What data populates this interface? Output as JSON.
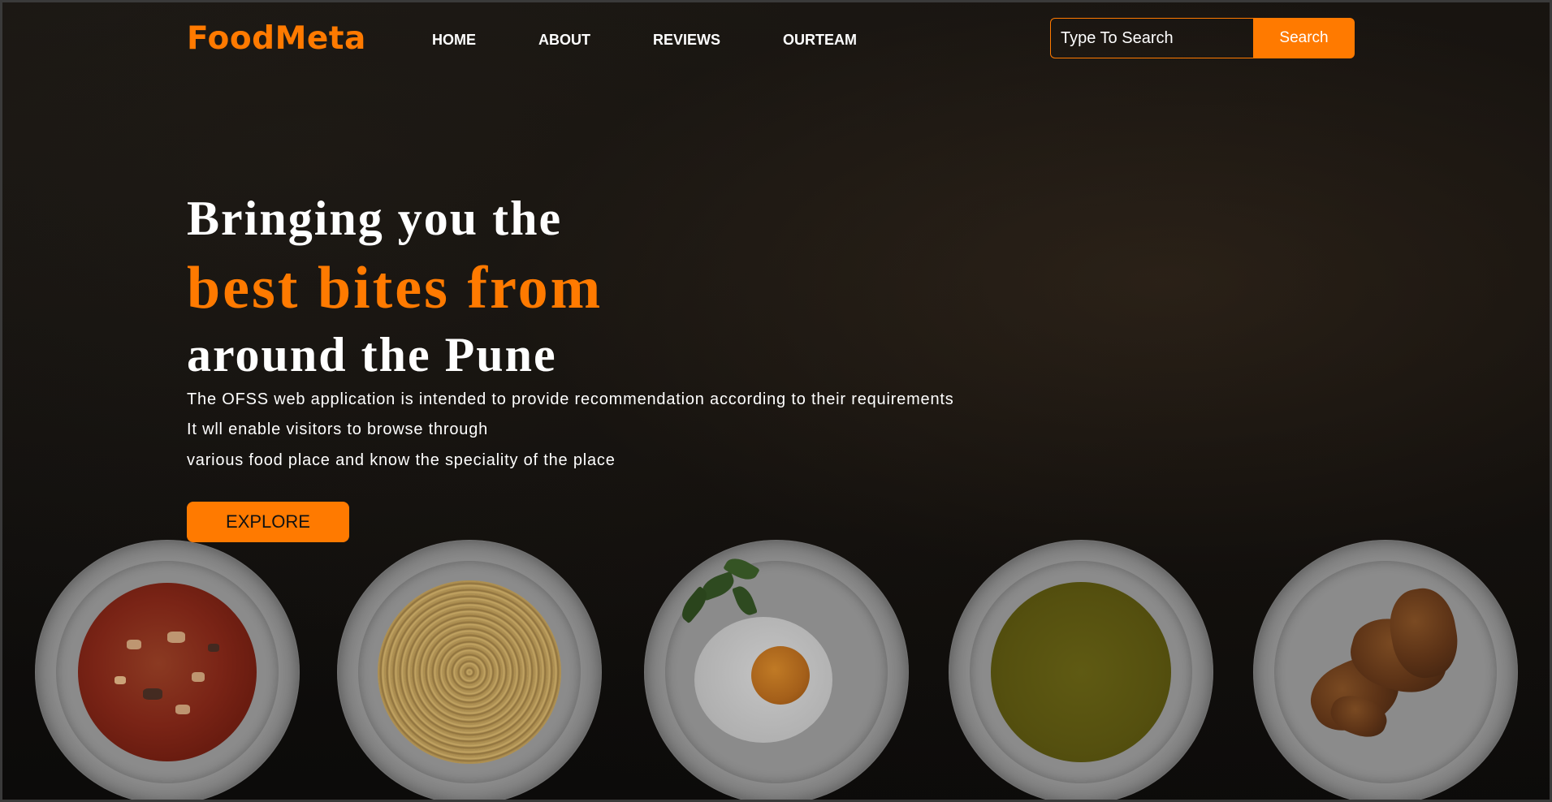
{
  "header": {
    "logo": "FoodMeta",
    "nav": [
      "HOME",
      "ABOUT",
      "REVIEWS",
      "OURTEAM"
    ],
    "search": {
      "value": "Type To Search",
      "placeholder": "Type To Search",
      "button_label": "Search"
    }
  },
  "hero": {
    "line1": "Bringing you the",
    "line2": "best bites from",
    "line3": "around the Pune",
    "description": [
      "The OFSS web application is intended to provide recommendation according to their requirements",
      "It wll enable visitors to browse through",
      "various food place and know the speciality of the place"
    ],
    "cta_label": "EXPLORE"
  },
  "plates": [
    {
      "icon": "soup-plate-icon"
    },
    {
      "icon": "spaghetti-plate-icon"
    },
    {
      "icon": "fried-egg-plate-icon"
    },
    {
      "icon": "green-soup-plate-icon"
    },
    {
      "icon": "croissant-plate-icon"
    }
  ],
  "colors": {
    "accent": "#ff7a00",
    "background": "#110f0d",
    "text": "#ffffff"
  }
}
